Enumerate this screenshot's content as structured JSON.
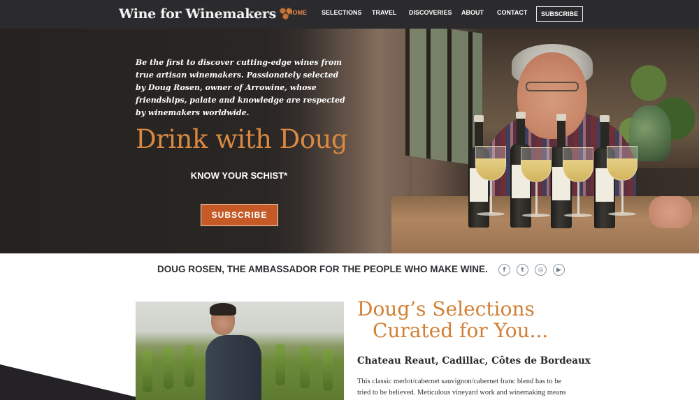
{
  "header": {
    "logo_text": "Wine for Winemakers",
    "logo_icon": "grapes-icon",
    "nav": [
      "HOME",
      "SELECTIONS",
      "TRAVEL",
      "DISCOVERIES",
      "ABOUT",
      "CONTACT"
    ],
    "active_nav": "HOME",
    "subscribe_label": "SUBSCRIBE"
  },
  "hero": {
    "tagline": "Be the first to discover cutting-edge wines from true artisan winemakers. Passionately selected by Doug Rosen, owner of Arrowine, whose friendships, palate and knowledge are respected by winemakers worldwide.",
    "title": "Drink with Doug",
    "subtitle": "KNOW YOUR SCHIST*",
    "button_label": "SUBSCRIBE"
  },
  "ambassador": {
    "text": "DOUG ROSEN, THE AMBASSADOR FOR THE PEOPLE WHO MAKE WINE.",
    "social": [
      {
        "icon": "facebook-icon",
        "glyph": "f"
      },
      {
        "icon": "twitter-icon",
        "glyph": "t"
      },
      {
        "icon": "instagram-icon",
        "glyph": "◎"
      },
      {
        "icon": "youtube-icon",
        "glyph": "▶"
      }
    ]
  },
  "selections": {
    "title_line1": "Doug’s Selections",
    "title_line2": "Curated for You...",
    "wine_name": "Chateau Reaut, Cadillac, Côtes de Bordeaux",
    "wine_description": "This classic merlot/cabernet sauvignon/cabernet franc blend has to be tried to be believed. Meticulous vineyard work and winemaking means this Bordeaux blend punches way up above its price point."
  },
  "colors": {
    "nav_bg": "#2b2a2d",
    "accent_orange": "#d98941",
    "button_orange": "#c65a26",
    "active_nav": "#e0874a"
  }
}
